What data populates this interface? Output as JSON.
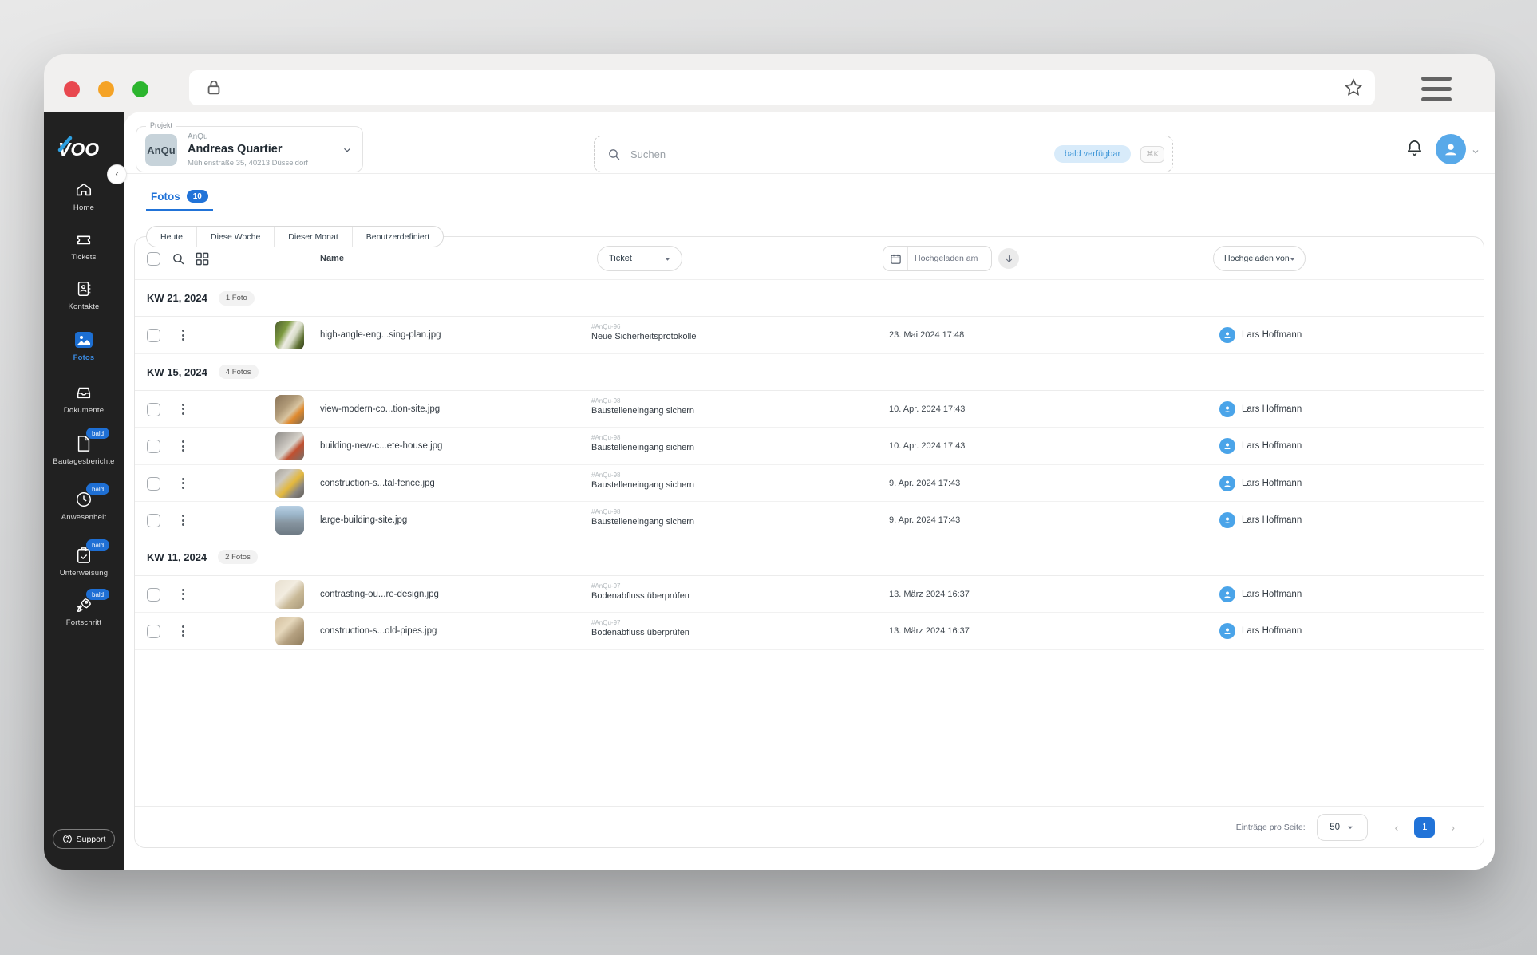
{
  "colors": {
    "accent_blue": "#2173d8",
    "avatar_blue": "#58a9e9",
    "badge_blue": "#1e6fd4",
    "sidebar_bg": "#212121",
    "traffic_red": "#e8484f",
    "traffic_yellow": "#f5a326",
    "traffic_green": "#2cb52e"
  },
  "sidebar": {
    "logo": "VOO",
    "support_label": "Support",
    "items": [
      {
        "label": "Home",
        "icon": "home-icon"
      },
      {
        "label": "Tickets",
        "icon": "ticket-icon"
      },
      {
        "label": "Kontakte",
        "icon": "contacts-icon"
      },
      {
        "label": "Fotos",
        "icon": "photos-icon",
        "active": true
      },
      {
        "label": "Dokumente",
        "icon": "documents-icon"
      },
      {
        "label": "Bautagesberichte",
        "icon": "report-icon",
        "badge": "bald"
      },
      {
        "label": "Anwesenheit",
        "icon": "attendance-icon",
        "badge": "bald"
      },
      {
        "label": "Unterweisung",
        "icon": "briefing-icon",
        "badge": "bald"
      },
      {
        "label": "Fortschritt",
        "icon": "progress-icon",
        "badge": "bald"
      }
    ]
  },
  "header": {
    "project_label": "Projekt",
    "project_avatar": "AnQu",
    "project_code": "AnQu",
    "project_name": "Andreas Quartier",
    "project_address": "Mühlenstraße 35, 40213 Düsseldorf",
    "search_placeholder": "Suchen",
    "search_badge": "bald verfügbar",
    "search_shortcut": "⌘K"
  },
  "tab": {
    "label": "Fotos",
    "count": "10"
  },
  "filters": [
    "Heute",
    "Diese Woche",
    "Dieser Monat",
    "Benutzerdefiniert"
  ],
  "table": {
    "columns": {
      "name": "Name",
      "ticket": "Ticket",
      "uploaded_at": "Hochgeladen am",
      "uploaded_by": "Hochgeladen von"
    },
    "groups": [
      {
        "week": "KW 21, 2024",
        "count_label": "1 Foto",
        "rows": [
          {
            "filename": "high-angle-eng...sing-plan.jpg",
            "ticket_ref": "#AnQu-96",
            "ticket_title": "Neue Sicherheitsprotokolle",
            "uploaded_at": "23. Mai 2024 17:48",
            "uploaded_by": "Lars Hoffmann",
            "thumb": "linear-gradient(120deg,#4e5f2f 0%,#7d9a3f 32%,#ecebe2 50%,#d8dcc8 62%,#5d7031 82%,#323d1e 100%)"
          }
        ]
      },
      {
        "week": "KW 15, 2024",
        "count_label": "4 Fotos",
        "rows": [
          {
            "filename": "view-modern-co...tion-site.jpg",
            "ticket_ref": "#AnQu-98",
            "ticket_title": "Baustelleneingang sichern",
            "uploaded_at": "10. Apr. 2024 17:43",
            "uploaded_by": "Lars Hoffmann",
            "thumb": "linear-gradient(135deg,#8a7458 0%,#b09a78 38%,#d8c4a0 58%,#e08a2e 72%,#7a6850 100%)"
          },
          {
            "filename": "building-new-c...ete-house.jpg",
            "ticket_ref": "#AnQu-98",
            "ticket_title": "Baustelleneingang sichern",
            "uploaded_at": "10. Apr. 2024 17:43",
            "uploaded_by": "Lars Hoffmann",
            "thumb": "linear-gradient(135deg,#8e8c88 0%,#bab6b0 32%,#d8d4cc 52%,#c05030 68%,#74716c 100%)"
          },
          {
            "filename": "construction-s...tal-fence.jpg",
            "ticket_ref": "#AnQu-98",
            "ticket_title": "Baustelleneingang sichern",
            "uploaded_at": "9. Apr. 2024 17:43",
            "uploaded_by": "Lars Hoffmann",
            "thumb": "linear-gradient(135deg,#a8a49c 0%,#ccc8c0 30%,#e4b83c 55%,#8a8680 76%,#5f5c58 100%)"
          },
          {
            "filename": "large-building-site.jpg",
            "ticket_ref": "#AnQu-98",
            "ticket_title": "Baustelleneingang sichern",
            "uploaded_at": "9. Apr. 2024 17:43",
            "uploaded_by": "Lars Hoffmann",
            "thumb": "linear-gradient(180deg,#b8d0e4 0%,#9ab4c8 32%,#8795a0 58%,#6e7a84 100%)"
          }
        ]
      },
      {
        "week": "KW 11, 2024",
        "count_label": "2 Fotos",
        "rows": [
          {
            "filename": "contrasting-ou...re-design.jpg",
            "ticket_ref": "#AnQu-97",
            "ticket_title": "Bodenabfluss überprüfen",
            "uploaded_at": "13. März 2024 16:37",
            "uploaded_by": "Lars Hoffmann",
            "thumb": "linear-gradient(135deg,#e8e0d0 0%,#f2ece0 40%,#c8b896 66%,#a89878 100%)"
          },
          {
            "filename": "construction-s...old-pipes.jpg",
            "ticket_ref": "#AnQu-97",
            "ticket_title": "Bodenabfluss überprüfen",
            "uploaded_at": "13. März 2024 16:37",
            "uploaded_by": "Lars Hoffmann",
            "thumb": "linear-gradient(135deg,#d4c0a0 0%,#e6d8bc 36%,#b4a080 62%,#8f7c5c 100%)"
          }
        ]
      }
    ]
  },
  "pagination": {
    "label": "Einträge pro Seite:",
    "page_size": "50",
    "current_page": "1"
  }
}
